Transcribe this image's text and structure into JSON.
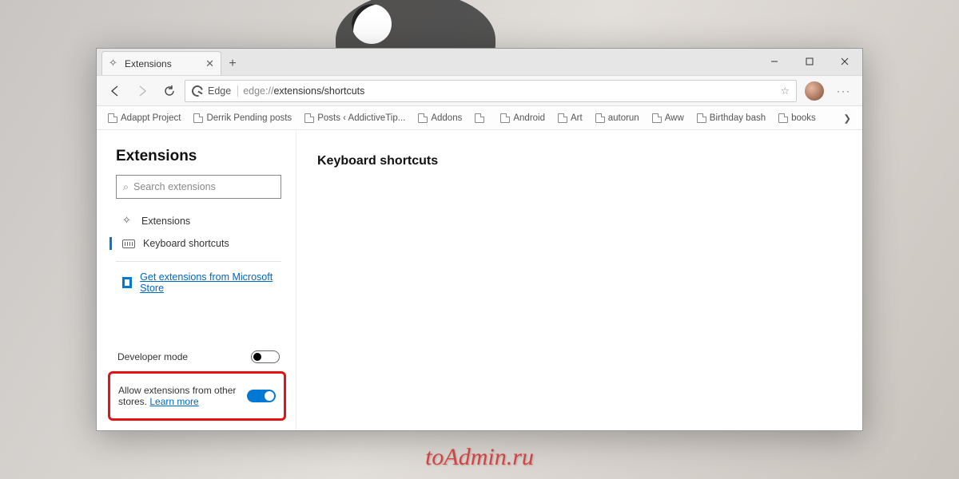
{
  "tab": {
    "title": "Extensions"
  },
  "addressbar": {
    "scheme_label": "Edge",
    "url_prefix": "edge://",
    "url_path": "extensions/shortcuts"
  },
  "bookmarks": [
    "Adappt Project",
    "Derrik Pending posts",
    "Posts ‹ AddictiveTip...",
    "Addons",
    "",
    "Android",
    "Art",
    "autorun",
    "Aww",
    "Birthday bash",
    "books"
  ],
  "sidebar": {
    "title": "Extensions",
    "search_placeholder": "Search extensions",
    "nav": {
      "extensions": "Extensions",
      "shortcuts": "Keyboard shortcuts"
    },
    "store_link": "Get extensions from Microsoft Store",
    "dev_mode_label": "Developer mode",
    "allow_other_label": "Allow extensions from other stores.",
    "learn_more": "Learn more"
  },
  "main": {
    "heading": "Keyboard shortcuts"
  },
  "watermark": "toAdmin.ru"
}
